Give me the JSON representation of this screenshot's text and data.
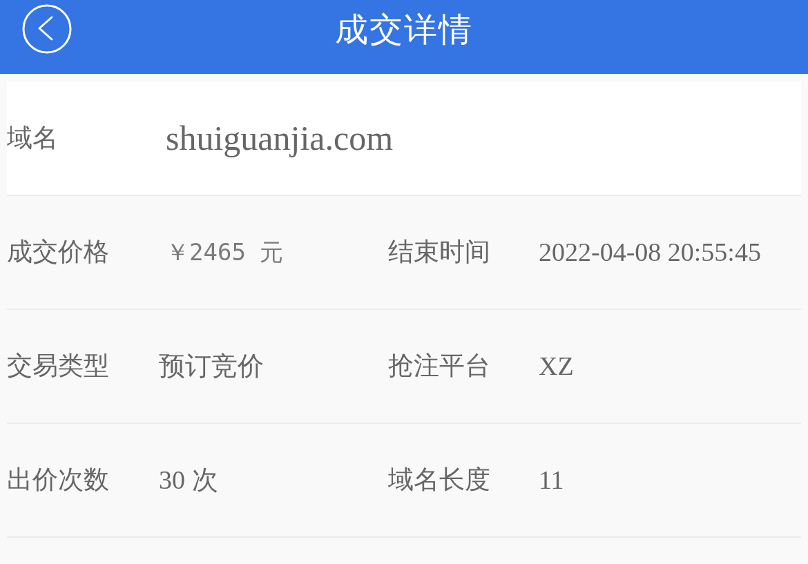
{
  "header": {
    "title": "成交详情"
  },
  "domain": {
    "label": "域名",
    "value": "shuiguanjia.com"
  },
  "rows": [
    {
      "cells": [
        {
          "label": "成交价格",
          "value": "￥2465 元",
          "kind": "price"
        },
        {
          "label": "结束时间",
          "value": "2022-04-08 20:55:45",
          "kind": "plain"
        }
      ]
    },
    {
      "cells": [
        {
          "label": "交易类型",
          "value": "预订竞价",
          "kind": "plain"
        },
        {
          "label": "抢注平台",
          "value": "XZ",
          "kind": "plain"
        }
      ]
    },
    {
      "cells": [
        {
          "label": "出价次数",
          "value": "30 次",
          "kind": "plain"
        },
        {
          "label": "域名长度",
          "value": "11",
          "kind": "plain"
        }
      ]
    }
  ]
}
